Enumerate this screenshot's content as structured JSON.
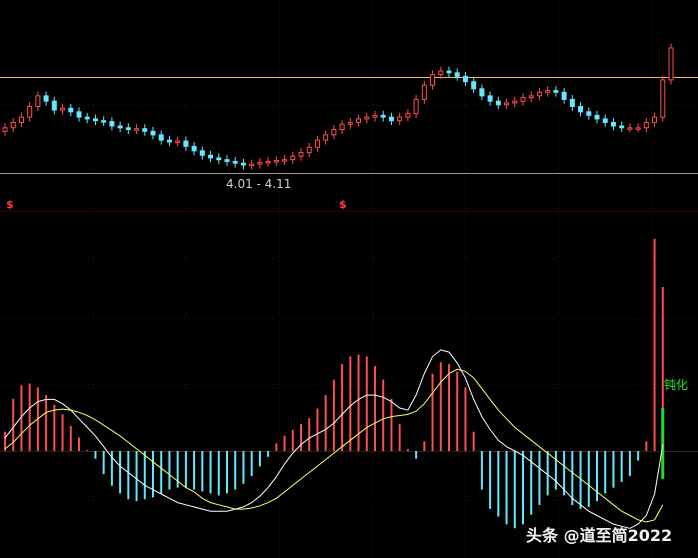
{
  "chart_data": [
    {
      "type": "candlestick",
      "resistance_level_color": "#e8c060",
      "support_level_color": "#9a9a9a",
      "range_label": "4.01 - 4.11",
      "signal_marks": [
        "$",
        "$"
      ],
      "series": [
        {
          "name": "",
          "closes": [
            1.0,
            1.3,
            1.6,
            2.2,
            2.8,
            2.5,
            2.0,
            2.1,
            1.9,
            1.6,
            1.5,
            1.4,
            1.35,
            1.1,
            1.0,
            0.9,
            0.95,
            0.8,
            0.6,
            0.3,
            0.2,
            0.25,
            -0.05,
            -0.3,
            -0.55,
            -0.7,
            -0.8,
            -0.9,
            -1.0,
            -1.1,
            -1.05,
            -0.95,
            -0.9,
            -0.85,
            -0.8,
            -0.6,
            -0.4,
            -0.1,
            0.3,
            0.6,
            0.9,
            1.2,
            1.3,
            1.5,
            1.6,
            1.7,
            1.6,
            1.4,
            1.6,
            1.8,
            2.6,
            3.4,
            4.0,
            4.2,
            4.1,
            3.9,
            3.6,
            3.2,
            2.8,
            2.5,
            2.3,
            2.4,
            2.5,
            2.7,
            2.8,
            3.0,
            3.1,
            3.0,
            2.6,
            2.2,
            1.9,
            1.7,
            1.5,
            1.3,
            1.1,
            1.0,
            1.0,
            1.0,
            1.3,
            1.6,
            3.7,
            5.5
          ]
        }
      ]
    },
    {
      "type": "macd",
      "divergence_label": "钝化",
      "series": [
        {
          "name": "",
          "histogram": [
            1.0,
            2.7,
            3.4,
            3.5,
            3.3,
            2.9,
            2.4,
            1.9,
            1.3,
            0.7,
            0.05,
            -0.4,
            -1.2,
            -1.8,
            -2.2,
            -2.5,
            -2.6,
            -2.5,
            -2.4,
            -2.2,
            -2.0,
            -1.9,
            -1.9,
            -2.0,
            -2.1,
            -2.2,
            -2.3,
            -2.2,
            -2.0,
            -1.7,
            -1.3,
            -0.8,
            -0.3,
            0.4,
            0.8,
            1.1,
            1.4,
            1.7,
            2.2,
            2.9,
            3.7,
            4.5,
            4.9,
            5.0,
            4.9,
            4.4,
            3.7,
            2.7,
            1.4,
            0.1,
            -0.4,
            0.5,
            4.0,
            4.6,
            4.5,
            4.1,
            3.3,
            1.0,
            -2.0,
            -3.0,
            -3.4,
            -3.8,
            -4.0,
            -3.8,
            -3.3,
            -2.8,
            -2.3,
            -2.0,
            -2.3,
            -2.8,
            -3.0,
            -2.9,
            -2.6,
            -2.2,
            -1.9,
            -1.6,
            -1.3,
            -0.5,
            0.5,
            11.0,
            8.5
          ]
        },
        {
          "name": "",
          "values": [
            0.6,
            1.1,
            1.6,
            2.0,
            2.3,
            2.4,
            2.4,
            2.2,
            1.9,
            1.5,
            1.1,
            0.7,
            0.2,
            -0.3,
            -0.7,
            -1.0,
            -1.3,
            -1.6,
            -1.8,
            -2.0,
            -2.2,
            -2.4,
            -2.5,
            -2.6,
            -2.7,
            -2.8,
            -2.8,
            -2.8,
            -2.7,
            -2.6,
            -2.4,
            -2.1,
            -1.7,
            -1.2,
            -0.6,
            -0.1,
            0.3,
            0.6,
            0.8,
            1.0,
            1.3,
            1.7,
            2.1,
            2.4,
            2.6,
            2.6,
            2.5,
            2.3,
            2.0,
            1.9,
            2.6,
            3.6,
            4.4,
            4.7,
            4.6,
            4.1,
            3.4,
            2.4,
            1.6,
            1.0,
            0.5,
            0.2,
            0.0,
            -0.2,
            -0.5,
            -0.8,
            -1.1,
            -1.4,
            -1.8,
            -2.2,
            -2.5,
            -2.8,
            -3.0,
            -3.2,
            -3.4,
            -3.5,
            -3.6,
            -3.4,
            -3.0,
            -2.0,
            0.3
          ]
        },
        {
          "name": "",
          "values": [
            0.1,
            0.4,
            0.8,
            1.2,
            1.5,
            1.8,
            1.9,
            1.95,
            1.9,
            1.8,
            1.65,
            1.45,
            1.2,
            0.95,
            0.7,
            0.4,
            0.1,
            -0.2,
            -0.5,
            -0.8,
            -1.1,
            -1.4,
            -1.7,
            -1.9,
            -2.2,
            -2.4,
            -2.5,
            -2.6,
            -2.7,
            -2.7,
            -2.65,
            -2.55,
            -2.4,
            -2.2,
            -1.9,
            -1.6,
            -1.3,
            -1.0,
            -0.7,
            -0.4,
            -0.1,
            0.2,
            0.5,
            0.8,
            1.1,
            1.3,
            1.5,
            1.6,
            1.65,
            1.7,
            1.85,
            2.2,
            2.7,
            3.2,
            3.6,
            3.8,
            3.7,
            3.4,
            2.9,
            2.4,
            1.9,
            1.5,
            1.1,
            0.8,
            0.5,
            0.2,
            -0.1,
            -0.4,
            -0.7,
            -1.0,
            -1.3,
            -1.6,
            -1.9,
            -2.2,
            -2.5,
            -2.8,
            -3.0,
            -3.2,
            -3.3,
            -3.2,
            -2.5
          ]
        }
      ]
    }
  ],
  "colors": {
    "up": "#ff4d4d",
    "down": "#66e6ff",
    "macd_line": "#ffffff",
    "signal_line": "#ffff66",
    "diverge_bar": "#22dd22"
  },
  "watermark": "头条 @道至简2022"
}
